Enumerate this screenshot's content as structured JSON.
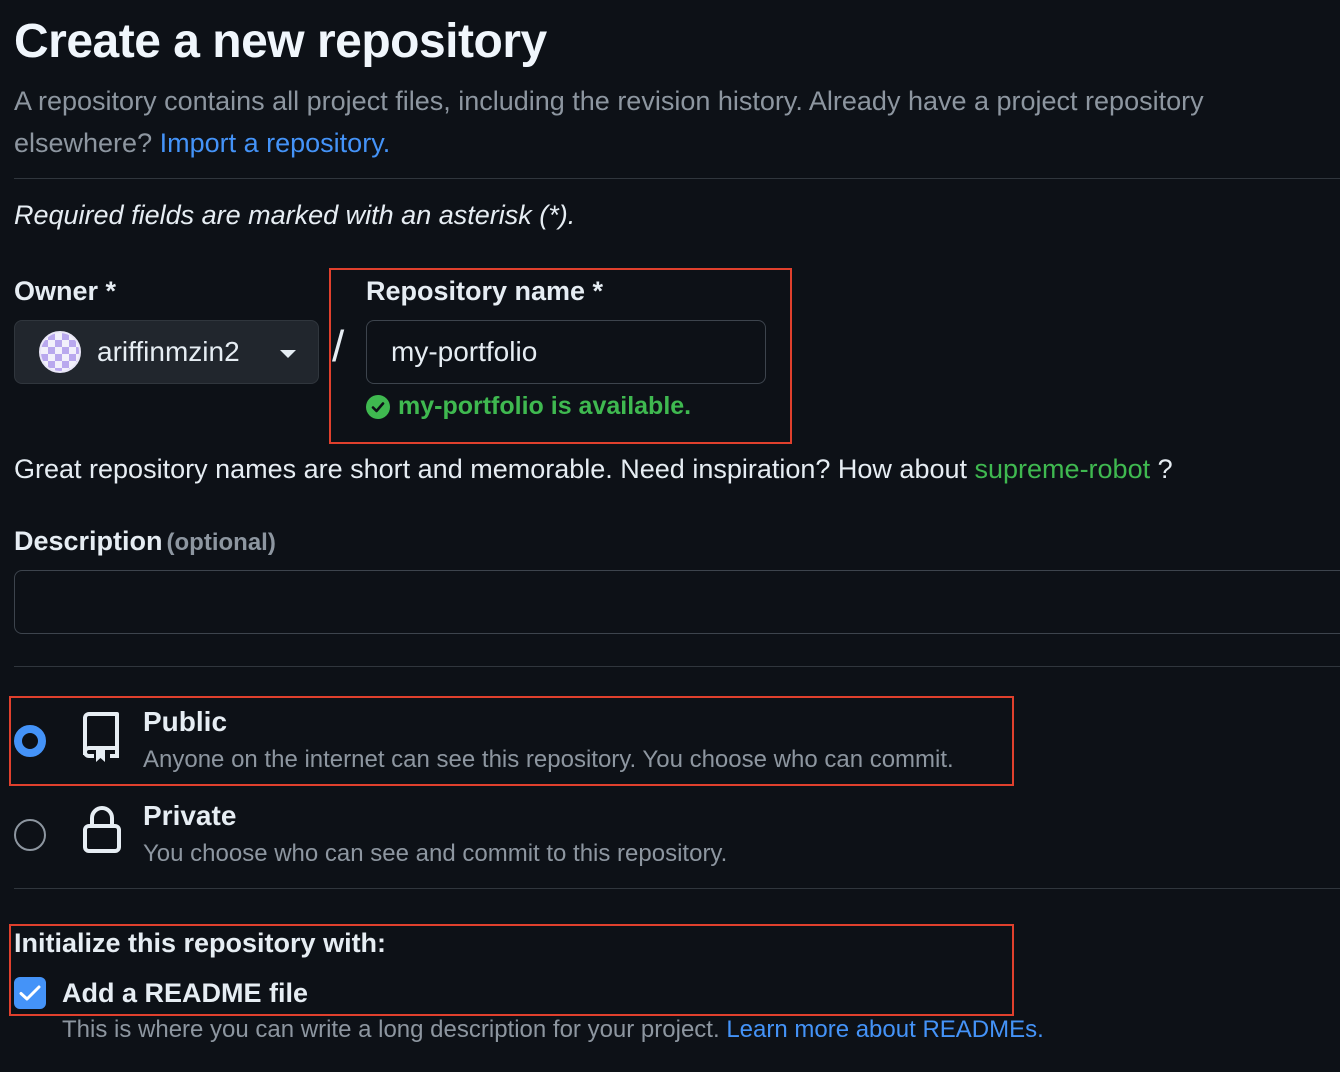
{
  "header": {
    "title": "Create a new repository",
    "intro_text": "A repository contains all project files, including the revision history. Already have a project repository elsewhere?",
    "import_link": "Import a repository."
  },
  "required_note": "Required fields are marked with an asterisk (*).",
  "owner": {
    "label": "Owner *",
    "value": "ariffinmzin2"
  },
  "separator": "/",
  "repo_name": {
    "label": "Repository name *",
    "value": "my-portfolio",
    "availability": "my-portfolio is available."
  },
  "suggestion": {
    "text": "Great repository names are short and memorable. Need inspiration? How about",
    "name": "supreme-robot",
    "suffix": "?"
  },
  "description": {
    "label": "Description",
    "optional": "(optional)",
    "value": ""
  },
  "visibility": {
    "public": {
      "title": "Public",
      "desc": "Anyone on the internet can see this repository. You choose who can commit.",
      "selected": true
    },
    "private": {
      "title": "Private",
      "desc": "You choose who can see and commit to this repository.",
      "selected": false
    }
  },
  "initialize": {
    "heading": "Initialize this repository with:",
    "readme_label": "Add a README file",
    "readme_checked": true,
    "readme_desc": "This is where you can write a long description for your project.",
    "readme_link": "Learn more about READMEs."
  },
  "colors": {
    "background": "#0d1117",
    "link": "#4493f8",
    "success": "#3fb950",
    "highlight_box": "#e0402d"
  }
}
